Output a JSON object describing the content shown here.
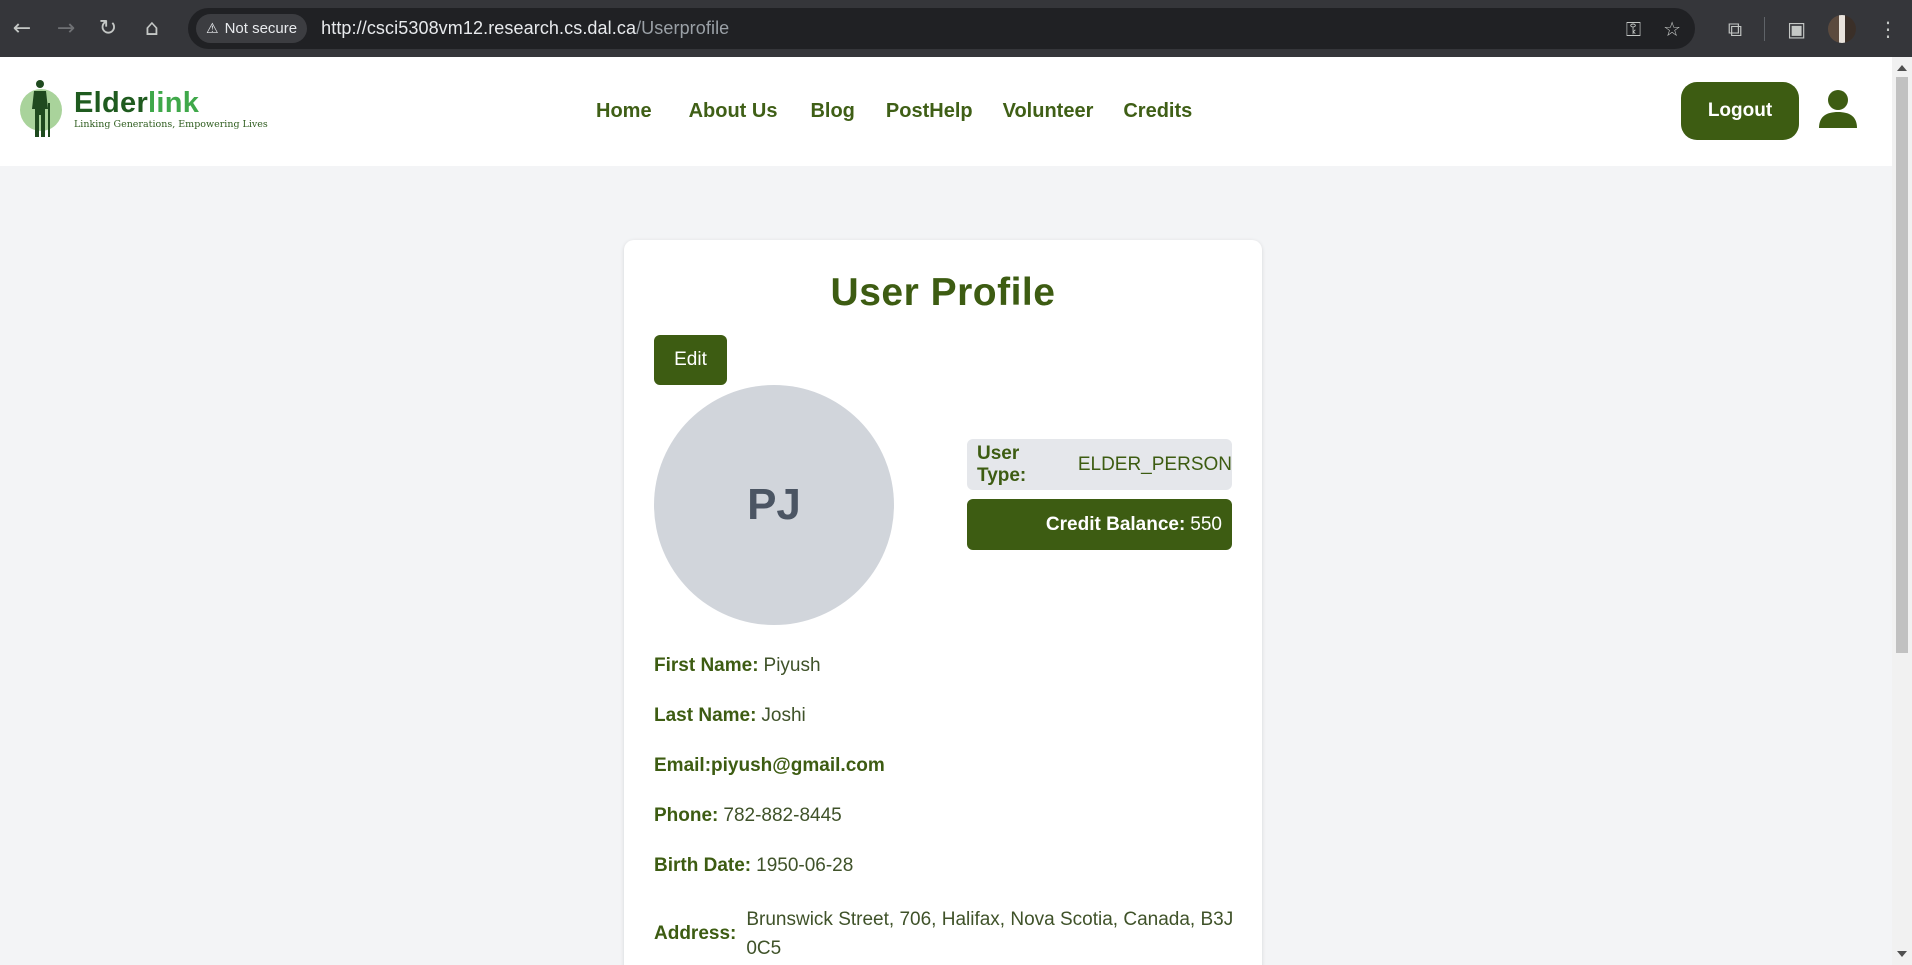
{
  "browser": {
    "security_label": "Not secure",
    "url_host": "http://csci5308vm12.research.cs.dal.ca",
    "url_path": "/Userprofile"
  },
  "site": {
    "logo_title_part1": "Elder",
    "logo_title_part2": "link",
    "tagline": "Linking Generations, Empowering Lives",
    "nav": [
      "Home",
      "About Us",
      "Blog",
      "PostHelp",
      "Volunteer",
      "Credits"
    ],
    "logout_label": "Logout"
  },
  "profile": {
    "title": "User Profile",
    "edit_label": "Edit",
    "initials": "PJ",
    "user_type_label": "User Type:",
    "user_type": "ELDER_PERSON",
    "credit_label": "Credit Balance:",
    "credit_balance": "550",
    "first_name_label": "First Name:",
    "first_name": "Piyush",
    "last_name_label": "Last Name:",
    "last_name": "Joshi",
    "email_label": "Email:",
    "email": "piyush@gmail.com",
    "phone_label": "Phone:",
    "phone": "782-882-8445",
    "birth_label": "Birth Date:",
    "birth_date": "1950-06-28",
    "address_label": "Address:",
    "address": "Brunswick Street, 706, Halifax, Nova Scotia, Canada, B3J 0C5"
  },
  "colors": {
    "brand_green": "#3d5c12",
    "logo_green": "#1f5b1f",
    "logo_accent": "#3fa84a",
    "page_bg": "#f3f4f6",
    "avatar_bg": "#d1d5db"
  },
  "icons": [
    "back-arrow-icon",
    "forward-arrow-icon",
    "reload-icon",
    "home-icon",
    "warning-icon",
    "key-icon",
    "star-icon",
    "extensions-icon",
    "side-panel-icon",
    "menu-dots-icon",
    "user-icon"
  ]
}
